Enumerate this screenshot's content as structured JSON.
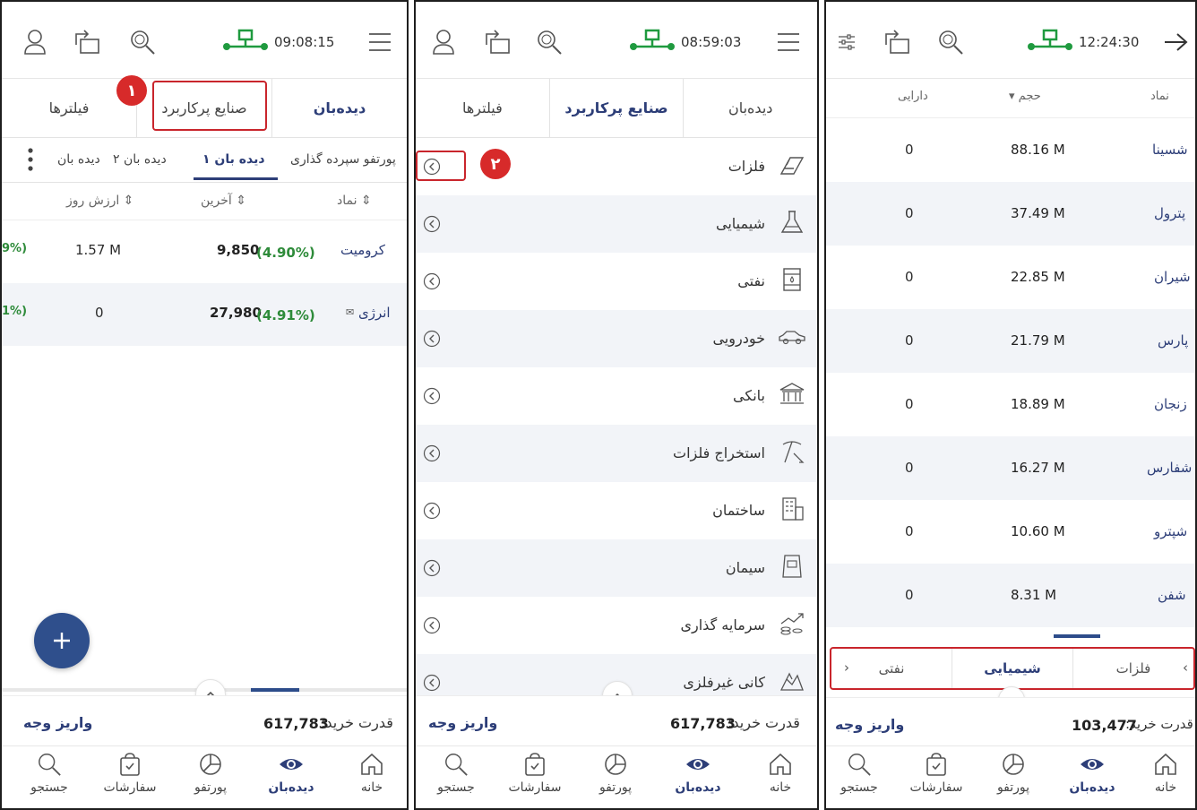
{
  "panel1": {
    "clock": "09:08:15",
    "tabs": [
      "فیلترها",
      "صنایع پرکاربرد",
      "دیده‌بان"
    ],
    "subtabs": [
      "دیده بان",
      "دیده بان ۲",
      "دیده بان ۱",
      "پورتفو سپرده گذاری"
    ],
    "columns": {
      "value": "ارزش روز",
      "last": "آخرین",
      "symbol": "نماد"
    },
    "rows": [
      {
        "pct_left": "9%)",
        "value": "1.57 M",
        "last": "9,850",
        "change": "(4.90%)",
        "symbol": "کرومیت"
      },
      {
        "pct_left": "1%)",
        "value": "0",
        "last": "27,980",
        "change": "(4.91%)",
        "symbol": "انرژی"
      }
    ],
    "buying_power_label": "قدرت خرید:",
    "buying_power_value": "617,783",
    "deposit": "واریز وجه",
    "badge": "۱"
  },
  "panel2": {
    "clock": "08:59:03",
    "tabs": [
      "فیلترها",
      "صنایع پرکاربرد",
      "دیده‌بان"
    ],
    "industries": [
      "فلزات",
      "شیمیایی",
      "نفتی",
      "خودرویی",
      "بانکی",
      "استخراج فلزات",
      "ساختمان",
      "سیمان",
      "سرمایه گذاری",
      "کانی غیرفلزی"
    ],
    "buying_power_label": "قدرت خرید:",
    "buying_power_value": "617,783",
    "deposit": "واریز وجه",
    "badge": "۲"
  },
  "panel3": {
    "clock": "12:24:30",
    "columns": {
      "asset": "دارایی",
      "volume": "حجم",
      "symbol": "نماد"
    },
    "rows": [
      {
        "asset": "0",
        "volume": "88.16 M",
        "symbol": "شسینا"
      },
      {
        "asset": "0",
        "volume": "37.49 M",
        "symbol": "پترول"
      },
      {
        "asset": "0",
        "volume": "22.85 M",
        "symbol": "شیران"
      },
      {
        "asset": "0",
        "volume": "21.79 M",
        "symbol": "پارس"
      },
      {
        "asset": "0",
        "volume": "18.89 M",
        "symbol": "زنجان"
      },
      {
        "asset": "0",
        "volume": "16.27 M",
        "symbol": "شفارس"
      },
      {
        "asset": "0",
        "volume": "10.60 M",
        "symbol": "شپترو"
      },
      {
        "asset": "0",
        "volume": "8.31 M",
        "symbol": "شفن"
      }
    ],
    "industry_bar": [
      "نفتی",
      "شیمیایی",
      "فلزات"
    ],
    "buying_power_label": "قدرت خرید:",
    "buying_power_value": "103,477",
    "deposit": "واریز وجه"
  },
  "bottom_nav": [
    "جستجو",
    "سفارشات",
    "پورتفو",
    "دیده‌بان",
    "خانه"
  ],
  "colors": {
    "accent": "#2d3e78",
    "green": "#2e8b3a",
    "highlight": "#c9252c",
    "fab": "#2f4f8c",
    "net": "#1f9a3f"
  }
}
